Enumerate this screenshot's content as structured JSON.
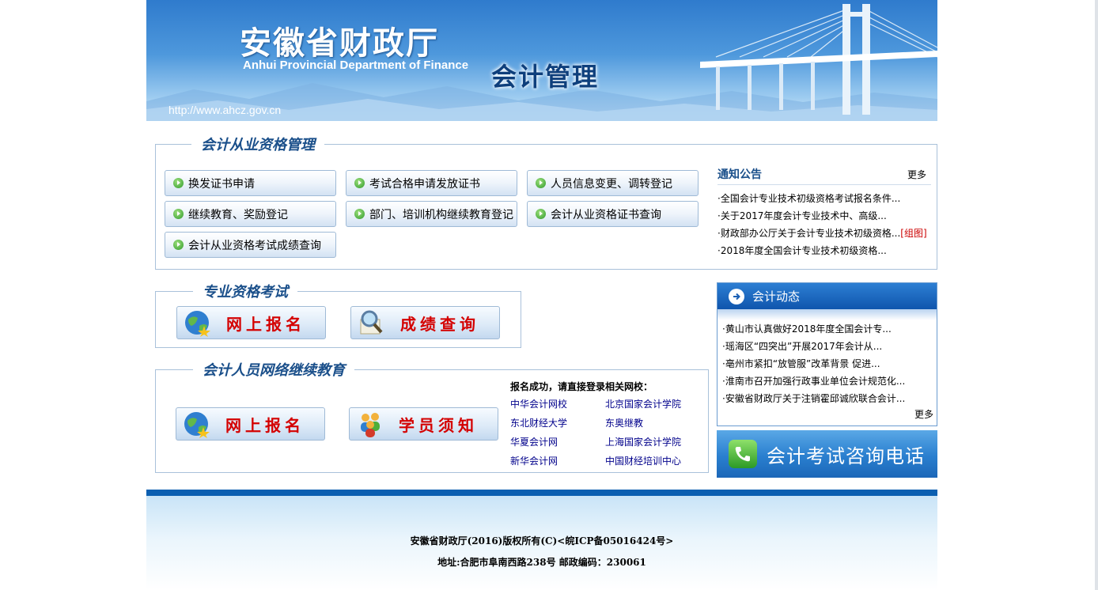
{
  "banner": {
    "title_cn": "安徽省财政厅",
    "title_en": "Anhui Provincial Department of Finance",
    "subtitle": "会计管理",
    "url": "http://www.ahcz.gov.cn"
  },
  "qualification": {
    "legend": "会计从业资格管理",
    "buttons": [
      "换发证书申请",
      "考试合格申请发放证书",
      "人员信息变更、调转登记",
      "继续教育、奖励登记",
      "部门、培训机构继续教育登记",
      "会计从业资格证书查询",
      "会计从业资格考试成绩查询"
    ]
  },
  "notice": {
    "title": "通知公告",
    "more": "更多",
    "items": [
      "·全国会计专业技术初级资格考试报名条件...",
      "·关于2017年度会计专业技术中、高级...",
      "·财政部办公厅关于会计专业技术初级资格...",
      "·2018年度全国会计专业技术初级资格..."
    ],
    "tag": "[组图]"
  },
  "exam": {
    "legend": "专业资格考试",
    "register": "网上报名",
    "score": "成绩查询"
  },
  "education": {
    "legend": "会计人员网络继续教育",
    "register": "网上报名",
    "notice": "学员须知",
    "links_title": "报名成功，请直接登录相关网校：",
    "links": [
      "中华会计网校",
      "北京国家会计学院",
      "东北财经大学",
      "东奥继教",
      "华夏会计网",
      "上海国家会计学院",
      "新华会计网",
      "中国财经培训中心"
    ]
  },
  "dynamics": {
    "title": "会计动态",
    "more": "更多",
    "items": [
      "·黄山市认真做好2018年度全国会计专...",
      "·瑶海区“四突出”开展2017年会计从...",
      "·亳州市紧扣“放管服”改革背景 促进...",
      "·淮南市召开加强行政事业单位会计规范化...",
      "·安徽省财政厅关于注销霍邱诚欣联合会计..."
    ]
  },
  "hotline": "会计考试咨询电话",
  "footer": {
    "copyright": "安徽省财政厅(2016)版权所有(C)<皖ICP备05016424号>",
    "address": "地址:合肥市阜南西路238号 邮政编码：230061"
  },
  "colors": {
    "brand": "#1a4f8a",
    "accent": "#d40000",
    "footer_bar": "#0b5fb1"
  }
}
